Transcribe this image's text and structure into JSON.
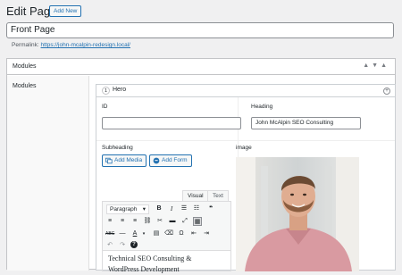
{
  "page": {
    "title": "Edit Page",
    "add_new_label": "Add New",
    "post_title_value": "Front Page",
    "permalink_label": "Permalink:",
    "permalink_url": "https://john-mcalpin-redesign.local/"
  },
  "postbox": {
    "title": "Modules",
    "label": "Modules",
    "controls": [
      "▲",
      "▼",
      "▲"
    ]
  },
  "layout": {
    "number": "1",
    "name": "Hero",
    "fields": {
      "id_label": "ID",
      "id_value": "",
      "heading_label": "Heading",
      "heading_value": "John McAlpin SEO Consulting",
      "subheading_label": "Subheading",
      "image_label": "image"
    }
  },
  "editor": {
    "add_media_label": "Add Media",
    "add_form_label": "Add Form",
    "tabs": [
      "Visual",
      "Text"
    ],
    "active_tab": "Visual",
    "format_select": "Paragraph",
    "content_line1": "Technical SEO Consulting &",
    "content_line2": "WordPress Development"
  },
  "colors": {
    "accent": "#2271b1",
    "background": "#f0f0f1",
    "border": "#c3c4c7"
  }
}
